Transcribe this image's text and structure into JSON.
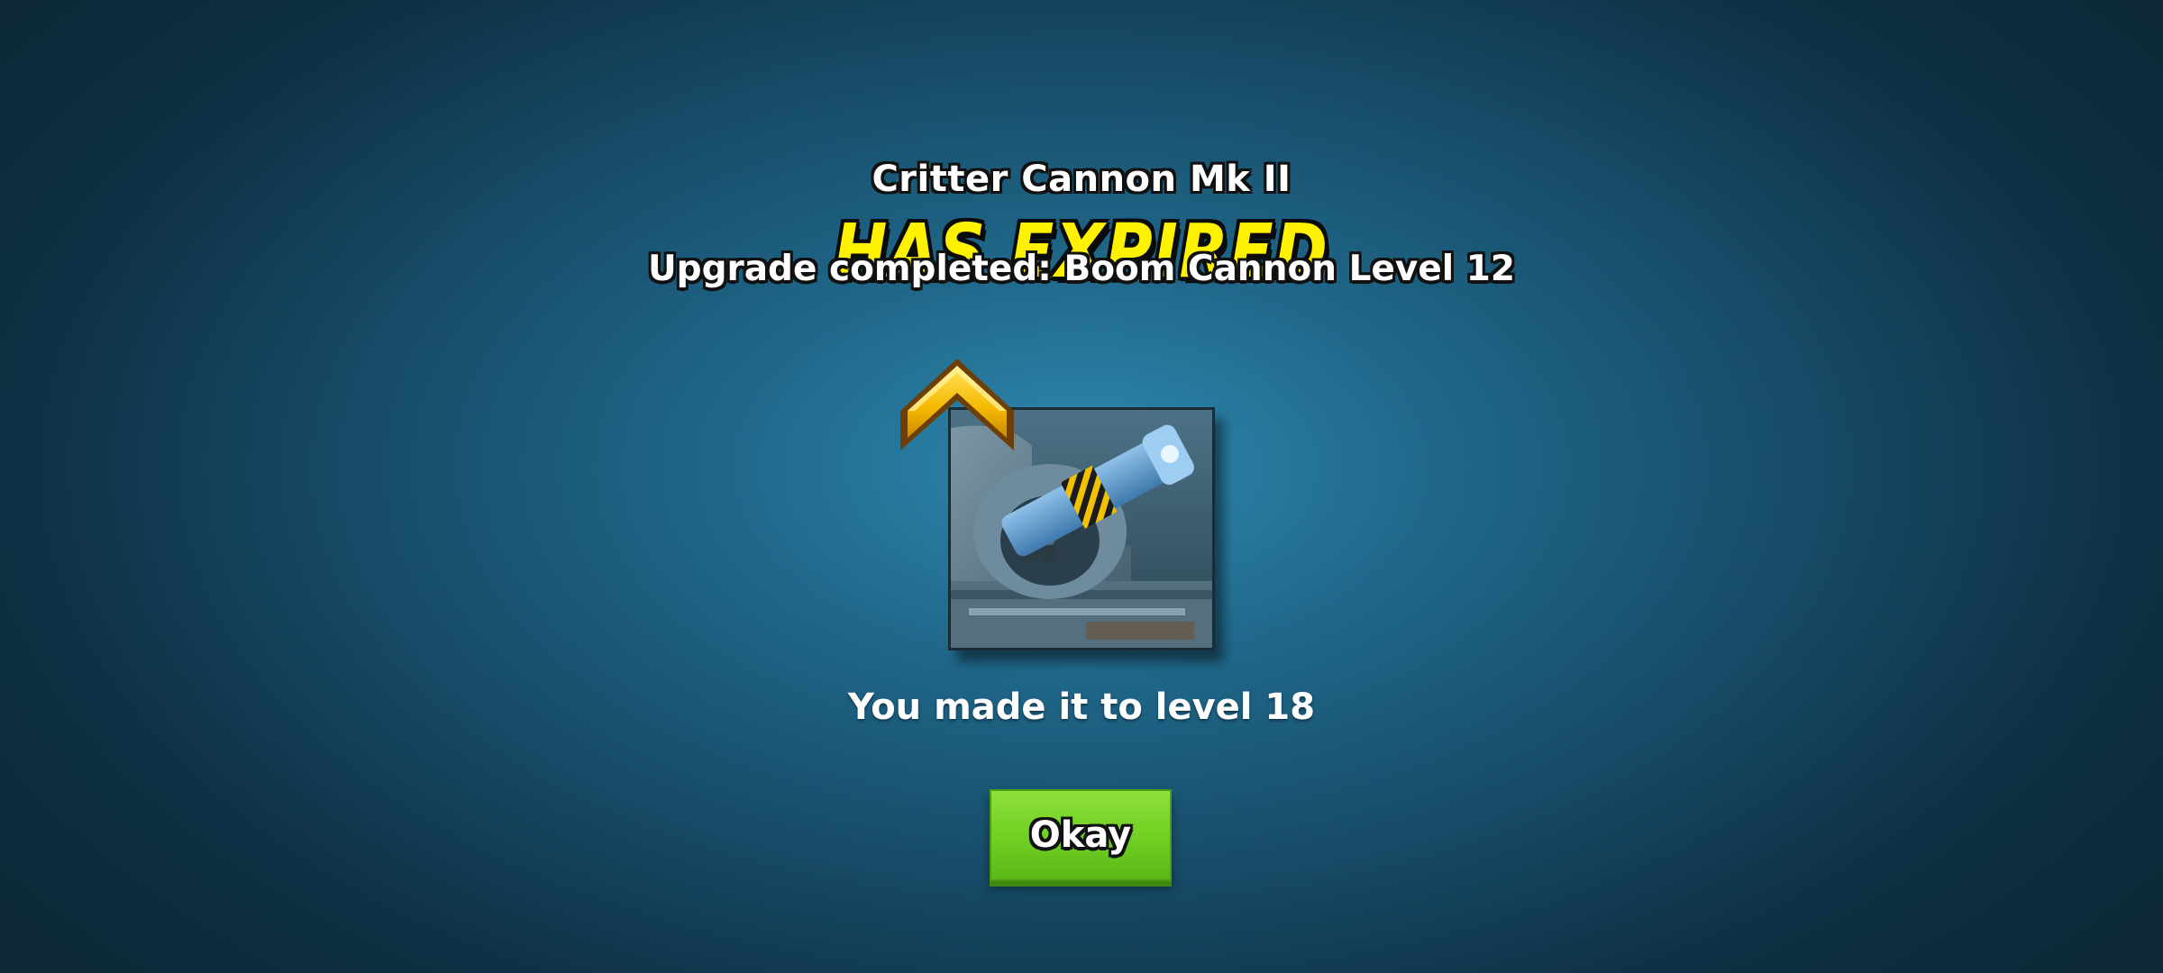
{
  "dialog": {
    "item_name": "Critter Cannon Mk II",
    "status_banner": "HAS EXPIRED",
    "upgrade_message": "Upgrade completed: Boom Cannon Level 12",
    "level_message": "You made it to level 18",
    "okay_label": "Okay"
  },
  "icons": {
    "upgrade_arrow": "gold-chevron-up-icon",
    "building_image": "boom-cannon-image"
  },
  "colors": {
    "banner_yellow": "#fff200",
    "button_green": "#6fcf22",
    "background_center": "#2f88b0",
    "background_edge": "#0c2838"
  }
}
